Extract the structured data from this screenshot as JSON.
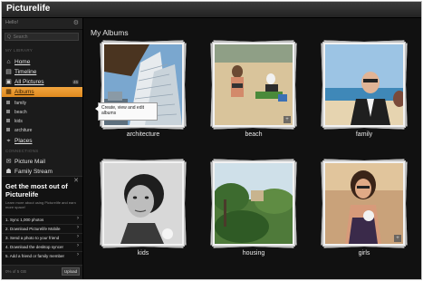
{
  "app": {
    "name": "Picturelife"
  },
  "sidebar": {
    "user": "Hello!",
    "search_placeholder": "Q  Search",
    "section_my_library": "MY LIBRARY",
    "section_connections": "CONNECTIONS",
    "nav": [
      {
        "label": "Home",
        "icon": "home-icon"
      },
      {
        "label": "Timeline",
        "icon": "timeline-icon"
      },
      {
        "label": "All Pictures",
        "icon": "pictures-icon",
        "count": "46"
      },
      {
        "label": "Albums",
        "icon": "albums-icon",
        "selected": true
      }
    ],
    "albums": [
      "family",
      "beach",
      "kids",
      "architure"
    ],
    "places_label": "Places",
    "connections": [
      {
        "label": "Picture Mail",
        "icon": "mail-icon"
      },
      {
        "label": "Family Stream",
        "icon": "family-stream-icon"
      }
    ]
  },
  "promo": {
    "title": "Get the most out of Picturelife",
    "desc": "Learn more about using Picturelife and earn more space!",
    "tasks": [
      "1. Sync 1,000 photos",
      "2. Download Picturelife Mobile",
      "3. Send a photo to your friend",
      "4. Download the desktop syncer",
      "5. Add a friend or family member"
    ]
  },
  "footer": {
    "storage": "0% of 5 GB",
    "upload": "Upload"
  },
  "main": {
    "title": "My Albums",
    "tooltip": "Create, view and edit albums",
    "albums": [
      {
        "label": "architecture"
      },
      {
        "label": "beach"
      },
      {
        "label": "family"
      },
      {
        "label": "kids"
      },
      {
        "label": "housing"
      },
      {
        "label": "girls"
      }
    ]
  },
  "colors": {
    "accent": "#e89a2c",
    "background": "#121212"
  }
}
